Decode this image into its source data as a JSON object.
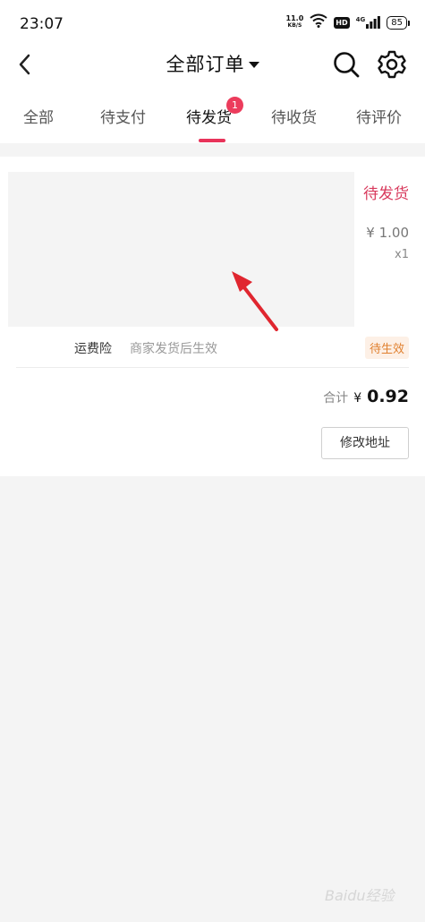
{
  "status_bar": {
    "time": "23:07",
    "net_speed_value": "11.0",
    "net_speed_unit": "KB/S",
    "hd_label": "HD",
    "network_label": "4G",
    "battery": "85"
  },
  "header": {
    "title": "全部订单"
  },
  "tabs": [
    {
      "label": "全部"
    },
    {
      "label": "待支付"
    },
    {
      "label": "待发货",
      "badge": "1",
      "active": true
    },
    {
      "label": "待收货"
    },
    {
      "label": "待评价"
    }
  ],
  "order": {
    "status": "待发货",
    "price": "¥ 1.00",
    "quantity": "x1",
    "insurance_label": "运费险",
    "insurance_desc": "商家发货后生效",
    "insurance_status": "待生效",
    "total_label": "合计",
    "total_currency": "¥",
    "total_amount": "0.92",
    "modify_address_label": "修改地址"
  },
  "colors": {
    "accent": "#e8335a",
    "badge_orange": "#e0802f",
    "background": "#f4f4f4"
  },
  "watermark": "Baidu经验",
  "icons": [
    "back-arrow-icon",
    "dropdown-caret-icon",
    "search-icon",
    "gear-icon",
    "wifi-icon",
    "signal-icon",
    "battery-icon"
  ]
}
